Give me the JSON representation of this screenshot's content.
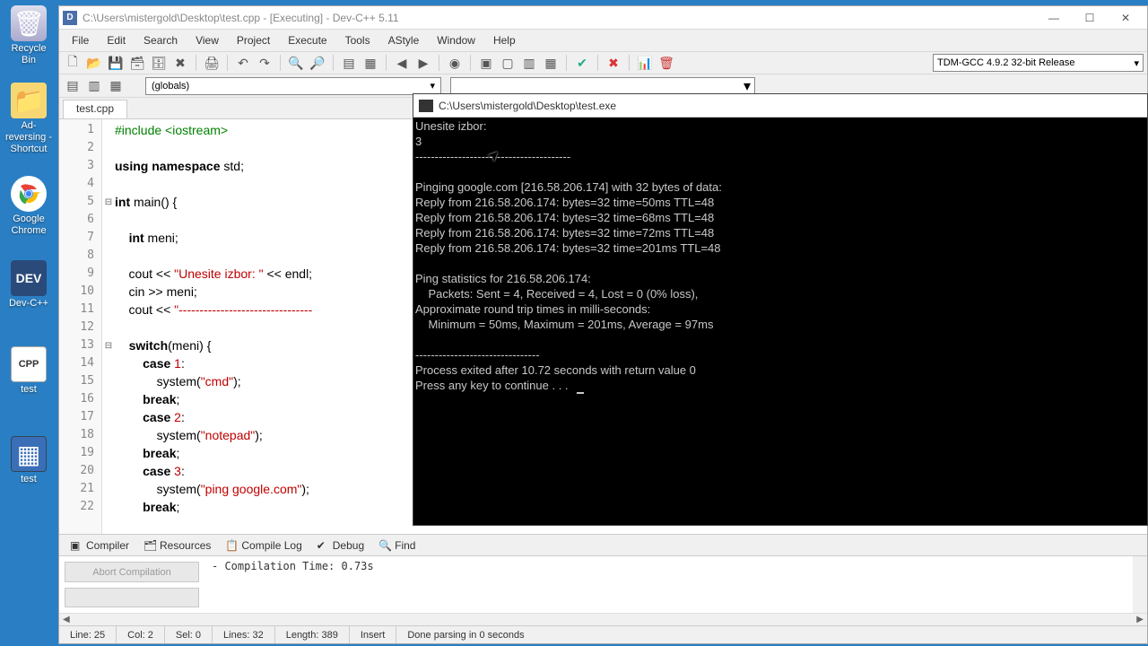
{
  "desktop": {
    "icons": [
      {
        "label": "Recycle Bin"
      },
      {
        "label": "Ad-reversing - Shortcut"
      },
      {
        "label": "Google Chrome"
      },
      {
        "label": "Dev-C++"
      },
      {
        "label": "test"
      },
      {
        "label": "test"
      }
    ]
  },
  "window": {
    "title": "C:\\Users\\mistergold\\Desktop\\test.cpp - [Executing] - Dev-C++ 5.11",
    "menu": [
      "File",
      "Edit",
      "Search",
      "View",
      "Project",
      "Execute",
      "Tools",
      "AStyle",
      "Window",
      "Help"
    ],
    "compiler": "TDM-GCC 4.9.2 32-bit Release",
    "globals": "(globals)",
    "tab": "test.cpp"
  },
  "code": {
    "lines": [
      {
        "n": 1,
        "html": "<span class='pre'>#include &lt;iostream&gt;</span>"
      },
      {
        "n": 2,
        "html": ""
      },
      {
        "n": 3,
        "html": "<span class='kw'>using</span> <span class='kw'>namespace</span> std;"
      },
      {
        "n": 4,
        "html": ""
      },
      {
        "n": 5,
        "html": "<span class='type'>int</span> main() {",
        "fold": true
      },
      {
        "n": 6,
        "html": ""
      },
      {
        "n": 7,
        "html": "    <span class='type'>int</span> meni;"
      },
      {
        "n": 8,
        "html": ""
      },
      {
        "n": 9,
        "html": "    cout &lt;&lt; <span class='str'>\"Unesite izbor: \"</span> &lt;&lt; endl;"
      },
      {
        "n": 10,
        "html": "    cin &gt;&gt; meni;"
      },
      {
        "n": 11,
        "html": "    cout &lt;&lt; <span class='str'>\"--------------------------------</span>"
      },
      {
        "n": 12,
        "html": ""
      },
      {
        "n": 13,
        "html": "    <span class='kw'>switch</span>(meni) {",
        "fold": true
      },
      {
        "n": 14,
        "html": "        <span class='kw'>case</span> <span class='num'>1</span>:"
      },
      {
        "n": 15,
        "html": "            system(<span class='str'>\"cmd\"</span>);"
      },
      {
        "n": 16,
        "html": "        <span class='kw'>break</span>;"
      },
      {
        "n": 17,
        "html": "        <span class='kw'>case</span> <span class='num'>2</span>:"
      },
      {
        "n": 18,
        "html": "            system(<span class='str'>\"notepad\"</span>);"
      },
      {
        "n": 19,
        "html": "        <span class='kw'>break</span>;"
      },
      {
        "n": 20,
        "html": "        <span class='kw'>case</span> <span class='num'>3</span>:"
      },
      {
        "n": 21,
        "html": "            system(<span class='str'>\"ping google.com\"</span>);"
      },
      {
        "n": 22,
        "html": "        <span class='kw'>break</span>;"
      }
    ]
  },
  "bottom_tabs": [
    "Compiler",
    "Resources",
    "Compile Log",
    "Debug",
    "Find"
  ],
  "bottom_panel": {
    "abort": "Abort Compilation",
    "msg": "- Compilation Time: 0.73s"
  },
  "status": {
    "line": "Line:   25",
    "col": "Col:   2",
    "sel": "Sel:   0",
    "lines": "Lines:   32",
    "length": "Length:   389",
    "mode": "Insert",
    "msg": "Done parsing in 0 seconds"
  },
  "console": {
    "title": "C:\\Users\\mistergold\\Desktop\\test.exe",
    "output": "Unesite izbor:\n3\n----------------------------------------\n\nPinging google.com [216.58.206.174] with 32 bytes of data:\nReply from 216.58.206.174: bytes=32 time=50ms TTL=48\nReply from 216.58.206.174: bytes=32 time=68ms TTL=48\nReply from 216.58.206.174: bytes=32 time=72ms TTL=48\nReply from 216.58.206.174: bytes=32 time=201ms TTL=48\n\nPing statistics for 216.58.206.174:\n    Packets: Sent = 4, Received = 4, Lost = 0 (0% loss),\nApproximate round trip times in milli-seconds:\n    Minimum = 50ms, Maximum = 201ms, Average = 97ms\n\n--------------------------------\nProcess exited after 10.72 seconds with return value 0\nPress any key to continue . . . "
  }
}
